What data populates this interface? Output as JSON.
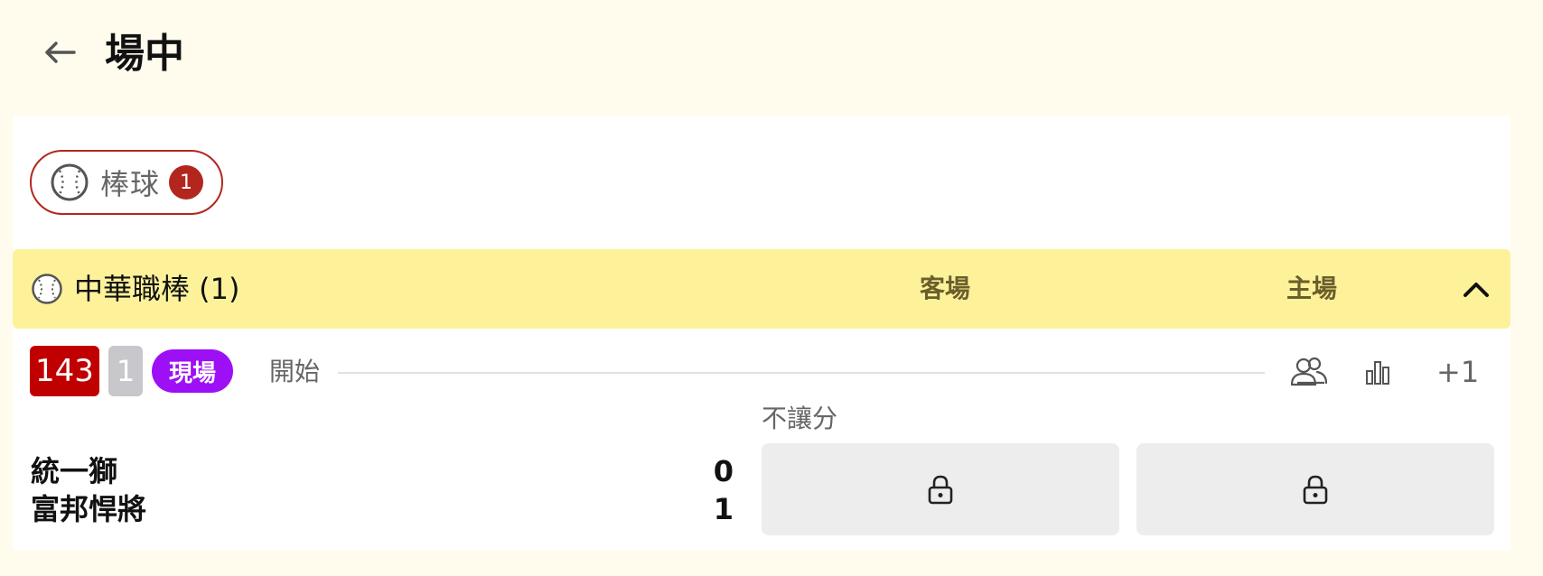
{
  "header": {
    "title": "場中",
    "back_icon": "arrow-left-icon"
  },
  "sport_filter": {
    "label": "棒球",
    "count": "1",
    "icon": "baseball-icon",
    "accent": "#b3261e"
  },
  "league": {
    "name": "中華職棒 (1)",
    "away_label": "客場",
    "home_label": "主場",
    "collapse_icon": "chevron-up-icon",
    "background": "#fdf29a"
  },
  "match": {
    "game_id": "143",
    "inning": "1",
    "status": "現場",
    "start_label": "開始",
    "actions": [
      "teams-icon",
      "stats-bar-icon"
    ],
    "more_markets": "+1",
    "market_label": "不讓分",
    "teams": [
      {
        "name": "統一獅",
        "score": "0"
      },
      {
        "name": "富邦悍將",
        "score": "1"
      }
    ],
    "odds": [
      {
        "icon": "lock-icon",
        "locked": true
      },
      {
        "icon": "lock-icon",
        "locked": true
      }
    ],
    "colors": {
      "game_id_bg": "#c00000",
      "live_bg": "#9d0ff5",
      "inning_bg": "#c8c8cc"
    }
  }
}
